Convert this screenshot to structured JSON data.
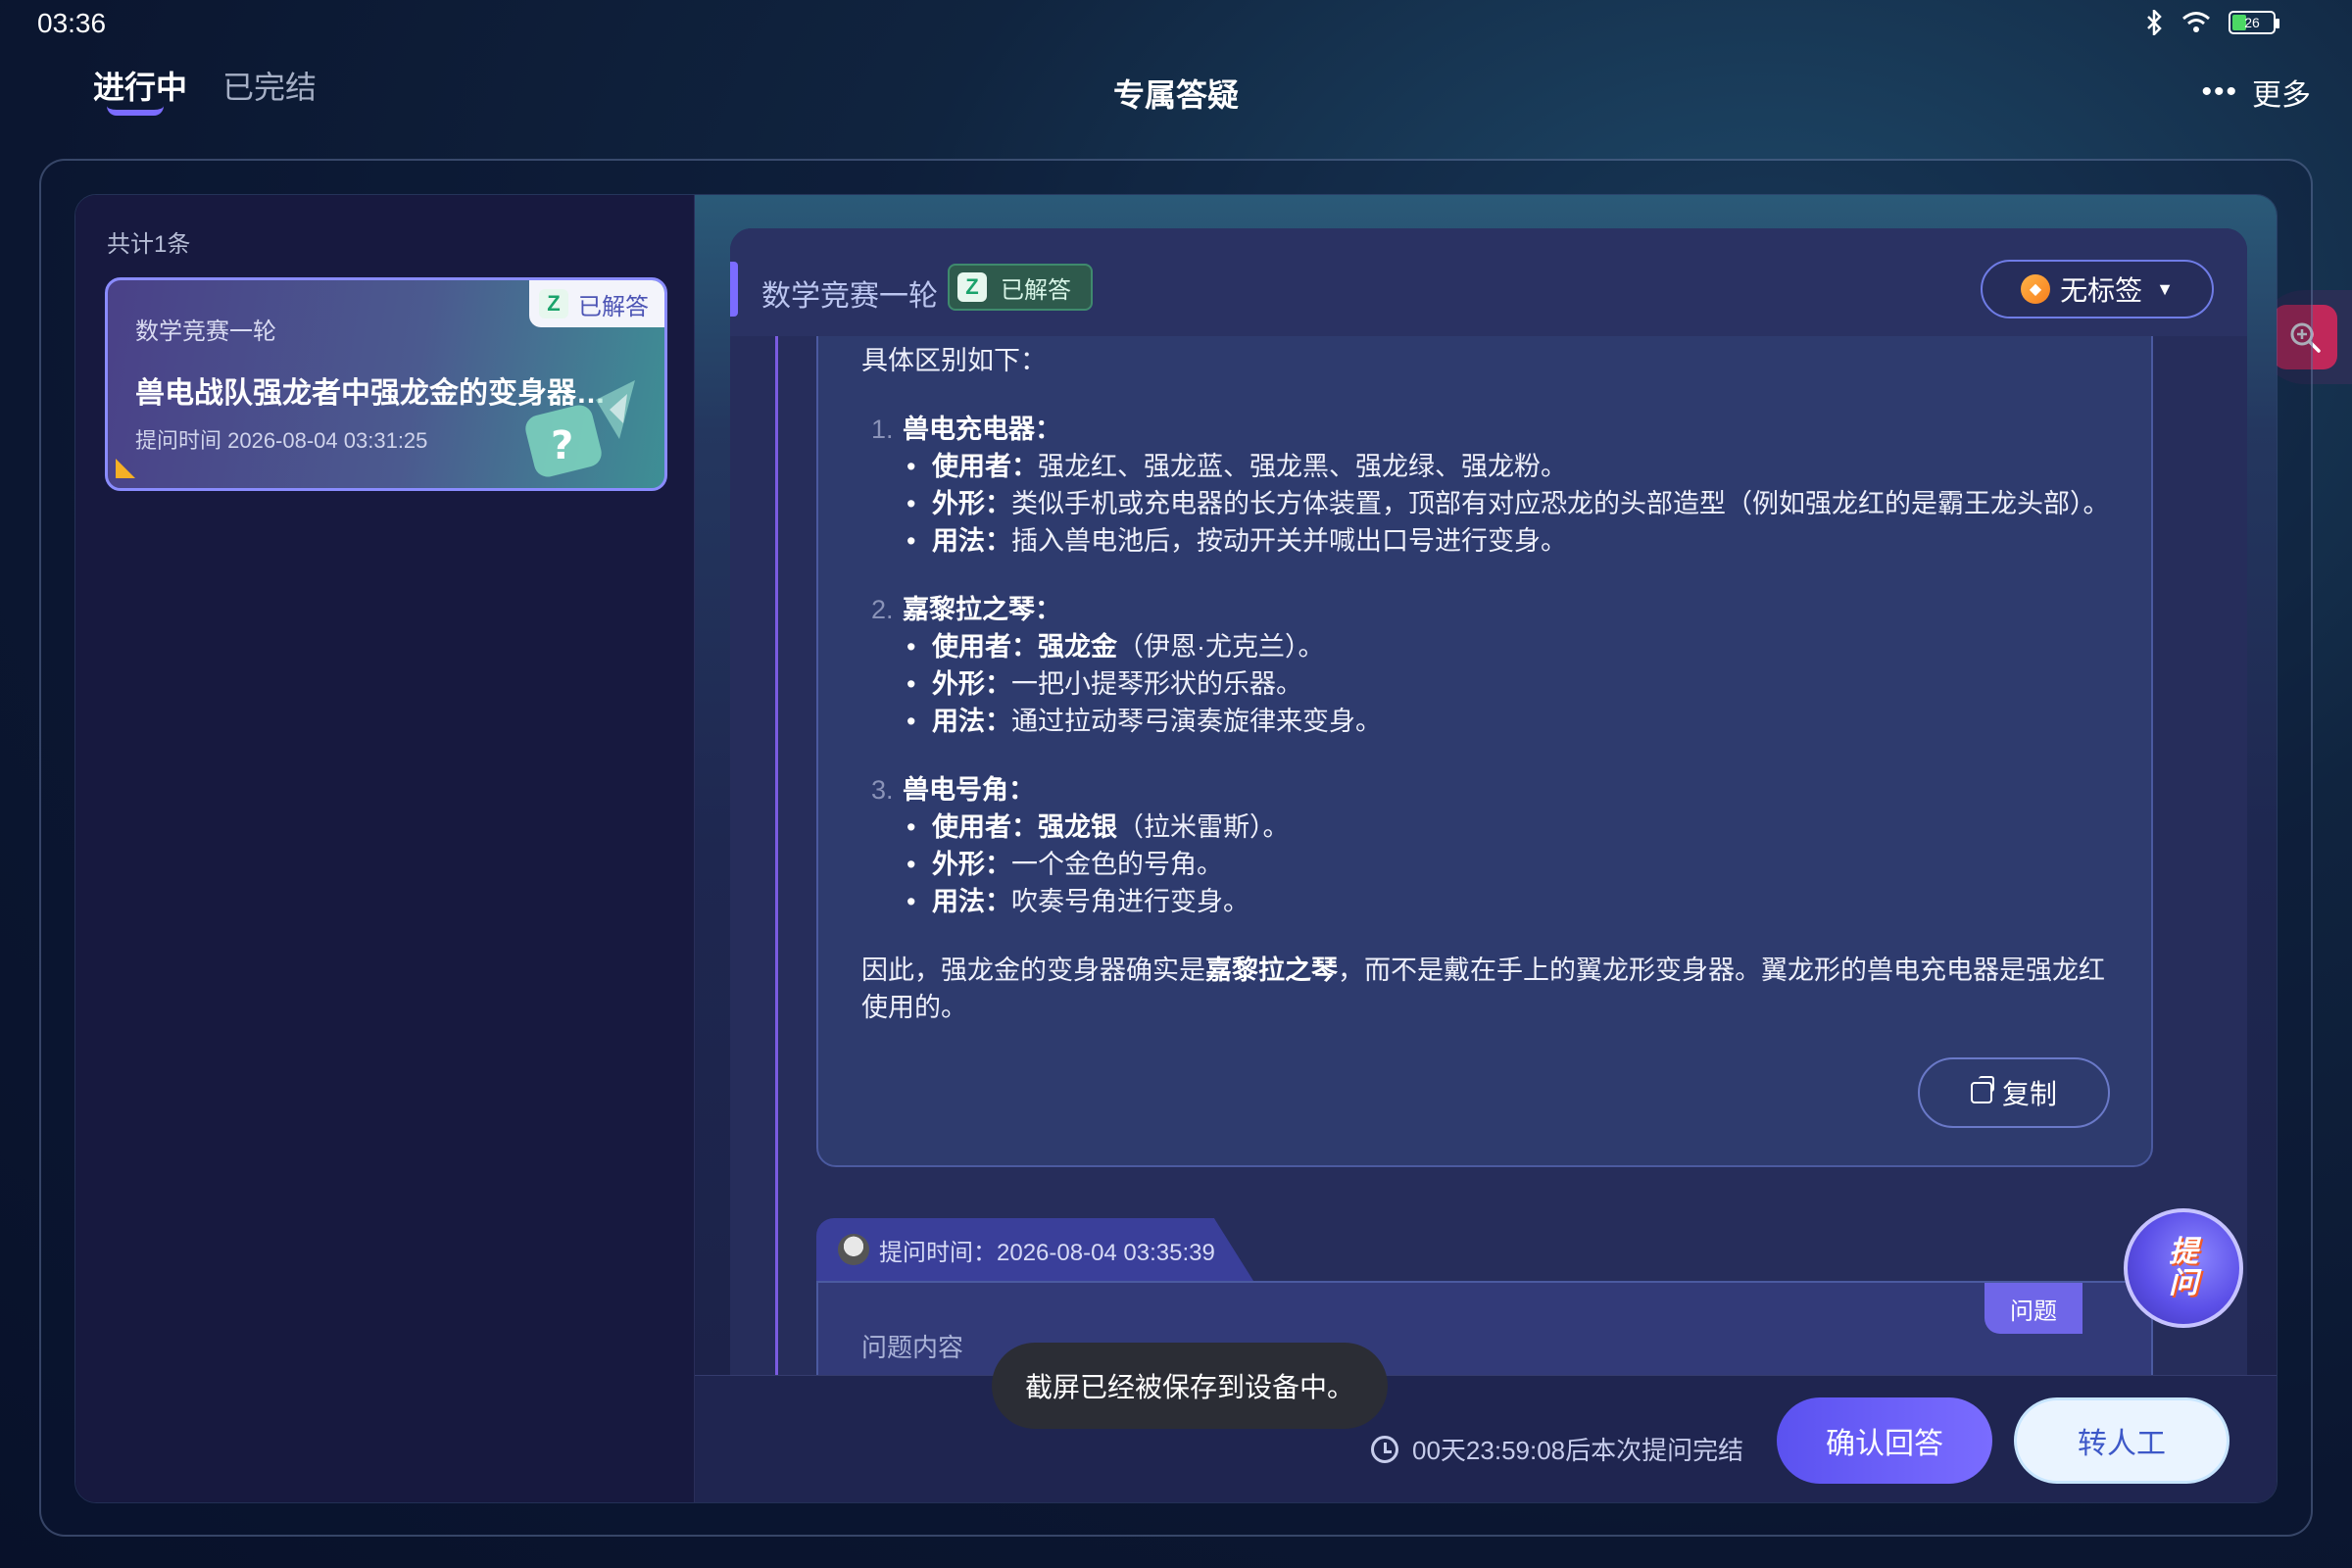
{
  "status_bar": {
    "time": "03:36",
    "battery": "26"
  },
  "nav": {
    "tabs": [
      {
        "label": "进行中",
        "active": true
      },
      {
        "label": "已完结",
        "active": false
      }
    ],
    "title": "专属答疑",
    "more_label": "更多"
  },
  "list": {
    "count_label": "共计1条",
    "cards": [
      {
        "category": "数学竞赛一轮",
        "status": "已解答",
        "title": "兽电战队强龙者中强龙金的变身器是……",
        "time": "提问时间 2026-08-04 03:31:25"
      }
    ]
  },
  "detail": {
    "header_title": "数学竞赛一轮",
    "header_status": "已解答",
    "tag_label": "无标签",
    "answer": {
      "intro": "具体区别如下：",
      "sections": [
        {
          "num": "1.",
          "title": "兽电充电器：",
          "items": [
            {
              "k": "使用者：",
              "v": "强龙红、强龙蓝、强龙黑、强龙绿、强龙粉。"
            },
            {
              "k": "外形：",
              "v": "类似手机或充电器的长方体装置，顶部有对应恐龙的头部造型（例如强龙红的是霸王龙头部）。"
            },
            {
              "k": "用法：",
              "v": "插入兽电池后，按动开关并喊出口号进行变身。"
            }
          ]
        },
        {
          "num": "2.",
          "title": "嘉黎拉之琴：",
          "items": [
            {
              "k": "使用者：",
              "vb": "强龙金",
              "v": "（伊恩·尤克兰）。"
            },
            {
              "k": "外形：",
              "v": "一把小提琴形状的乐器。"
            },
            {
              "k": "用法：",
              "v": "通过拉动琴弓演奏旋律来变身。"
            }
          ]
        },
        {
          "num": "3.",
          "title": "兽电号角：",
          "items": [
            {
              "k": "使用者：",
              "vb": "强龙银",
              "v": "（拉米雷斯）。"
            },
            {
              "k": "外形：",
              "v": "一个金色的号角。"
            },
            {
              "k": "用法：",
              "v": "吹奏号角进行变身。"
            }
          ]
        }
      ],
      "conclusion_pre": "因此，强龙金的变身器确实是",
      "conclusion_bold": "嘉黎拉之琴",
      "conclusion_post": "，而不是戴在手上的翼龙形变身器。翼龙形的兽电充电器是强龙红使用的。",
      "copy_label": "复制"
    },
    "ask": {
      "time_label": "提问时间：2026-08-04 03:35:39",
      "question_tag": "问题",
      "question_placeholder": "问题内容",
      "mascot_label": "提问"
    },
    "footer": {
      "timer": "00天23:59:08后本次提问完结",
      "confirm_label": "确认回答",
      "manual_label": "转人工"
    }
  },
  "toast": "截屏已经被保存到设备中。",
  "colors": {
    "accent": "#7b6cff",
    "answered_green": "#1aa36b",
    "danger": "#c0285a"
  }
}
